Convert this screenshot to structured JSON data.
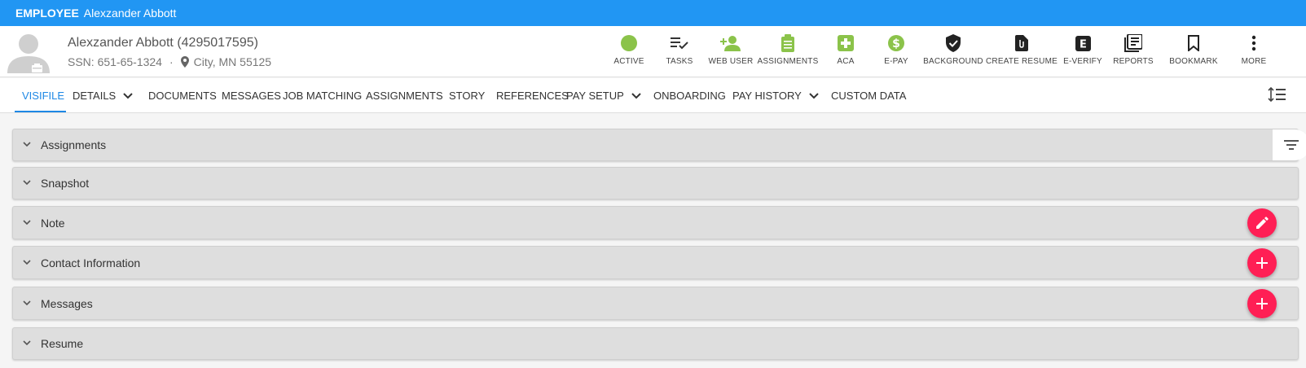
{
  "titlebar": {
    "type": "EMPLOYEE",
    "name": "Alexzander Abbott"
  },
  "employee": {
    "name_line": "Alexzander Abbott (4295017595)",
    "ssn": "SSN: 651-65-1324",
    "separator": "·",
    "location": "City, MN 55125"
  },
  "actions": [
    {
      "label": "ACTIVE",
      "icon": "status-circle-icon",
      "color": "#8bc34a"
    },
    {
      "label": "TASKS",
      "icon": "playlist-check-icon",
      "color": "#333333"
    },
    {
      "label": "WEB USER",
      "icon": "person-add-icon",
      "color": "#8bc34a"
    },
    {
      "label": "ASSIGNMENTS",
      "icon": "clipboard-icon",
      "color": "#8bc34a"
    },
    {
      "label": "ACA",
      "icon": "medical-plus-icon",
      "color": "#8bc34a"
    },
    {
      "label": "E-PAY",
      "icon": "dollar-circle-icon",
      "color": "#8bc34a"
    },
    {
      "label": "BACKGROUND",
      "icon": "shield-check-icon",
      "color": "#222222"
    },
    {
      "label": "CREATE RESUME",
      "icon": "file-attach-icon",
      "color": "#222222"
    },
    {
      "label": "E-VERIFY",
      "icon": "e-verify-icon",
      "color": "#222222"
    },
    {
      "label": "REPORTS",
      "icon": "library-books-icon",
      "color": "#222222"
    },
    {
      "label": "BOOKMARK",
      "icon": "bookmark-icon",
      "color": "#222222"
    },
    {
      "label": "MORE",
      "icon": "more-vertical-icon",
      "color": "#222222"
    }
  ],
  "tabs": [
    {
      "label": "VISIFILE",
      "active": true
    },
    {
      "label": "DETAILS",
      "dropdown": true
    },
    {
      "label": "DOCUMENTS"
    },
    {
      "label": "MESSAGES"
    },
    {
      "label": "JOB MATCHING"
    },
    {
      "label": "ASSIGNMENTS"
    },
    {
      "label": "STORY"
    },
    {
      "label": "REFERENCES"
    },
    {
      "label": "PAY SETUP",
      "dropdown": true
    },
    {
      "label": "ONBOARDING"
    },
    {
      "label": "PAY HISTORY",
      "dropdown": true
    },
    {
      "label": "CUSTOM DATA"
    }
  ],
  "panels": [
    {
      "title": "Assignments",
      "tool": "filter-icon"
    },
    {
      "title": "Snapshot"
    },
    {
      "title": "Note",
      "fab": "pencil-icon"
    },
    {
      "title": "Contact Information",
      "fab": "plus-icon"
    },
    {
      "title": "Messages",
      "fab": "plus-icon"
    },
    {
      "title": "Resume"
    }
  ],
  "colors": {
    "accent": "#2196f3",
    "fab": "#ff1f55",
    "active_green": "#8bc34a",
    "tab_active": "#1e88e5"
  }
}
